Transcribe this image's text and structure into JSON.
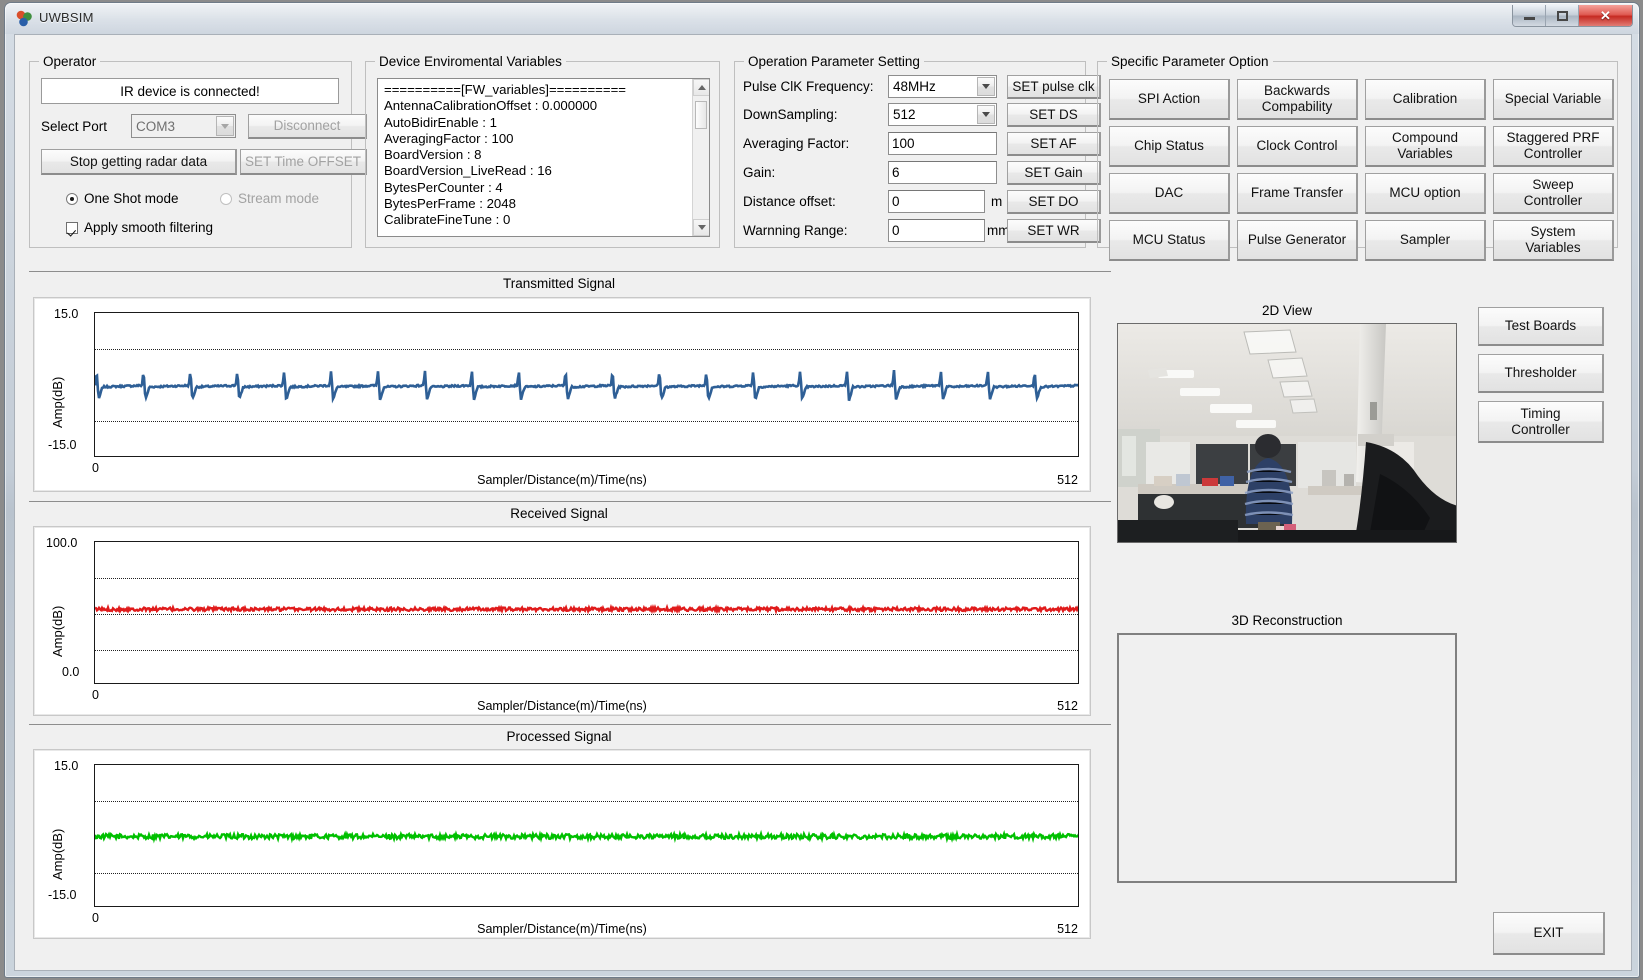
{
  "window": {
    "title": "UWBSIM",
    "minimize_label": "minimize",
    "maximize_label": "maximize",
    "close_label": "✕"
  },
  "operator": {
    "legend": "Operator",
    "status": "IR device is connected!",
    "select_port_label": "Select Port",
    "port_value": "COM3",
    "disconnect_label": "Disconnect",
    "stop_label": "Stop getting radar data",
    "time_offset_label": "SET Time OFFSET",
    "one_shot_label": "One Shot mode",
    "stream_label": "Stream mode",
    "smooth_label": "Apply smooth filtering"
  },
  "device_vars": {
    "legend": "Device Enviromental Variables",
    "text": "==========[FW_variables]==========\nAntennaCalibrationOffset : 0.000000\nAutoBidirEnable : 1\nAveragingFactor : 100\nBoardVersion : 8\nBoardVersion_LiveRead : 16\nBytesPerCounter : 4\nBytesPerFrame : 2048\nCalibrateFineTune : 0"
  },
  "operation": {
    "legend": "Operation Parameter Setting",
    "rows": [
      {
        "label": "Pulse ClK Frequency:",
        "value": "48MHz",
        "kind": "combo",
        "unit": "",
        "button": "SET pulse clk"
      },
      {
        "label": "DownSampling:",
        "value": "512",
        "kind": "combo",
        "unit": "",
        "button": "SET DS"
      },
      {
        "label": "Averaging Factor:",
        "value": "100",
        "kind": "text",
        "unit": "",
        "button": "SET AF"
      },
      {
        "label": "Gain:",
        "value": "6",
        "kind": "text",
        "unit": "",
        "button": "SET Gain"
      },
      {
        "label": "Distance offset:",
        "value": "0",
        "kind": "text",
        "unit": "m",
        "button": "SET DO"
      },
      {
        "label": "Warnning Range:",
        "value": "0",
        "kind": "text",
        "unit": "mm",
        "button": "SET WR"
      }
    ]
  },
  "specific": {
    "legend": "Specific Parameter Option",
    "buttons": [
      "SPI Action",
      "Backwards\nCompability",
      "Calibration",
      "Special Variable",
      "Chip Status",
      "Clock Control",
      "Compound\nVariables",
      "Staggered PRF\nController",
      "DAC",
      "Frame Transfer",
      "MCU option",
      "Sweep\nController",
      "MCU Status",
      "Pulse Generator",
      "Sampler",
      "System\nVariables"
    ]
  },
  "side_buttons": {
    "test_boards": "Test Boards",
    "thresholder": "Thresholder",
    "timing_controller": "Timing\nController",
    "exit": "EXIT"
  },
  "views": {
    "view_2d_title": "2D View",
    "recon_title": "3D Reconstruction"
  },
  "chart_data": [
    {
      "type": "line",
      "title": "Transmitted Signal",
      "ylabel": "Amp(dB)",
      "xlabel": "Sampler/Distance(m)/Time(ns)",
      "yticks": [
        "15.0",
        "-15.0"
      ],
      "ylim": [
        -15.0,
        15.0
      ],
      "xticks": [
        "0",
        "512"
      ],
      "xlim": [
        0,
        512
      ],
      "grid": true,
      "gridlines_y": [
        7.5,
        -7.5
      ],
      "series": [
        {
          "name": "transmitted",
          "color": "#2e5f96",
          "description": "Periodic sawtooth pulse train, ~21 cycles across 512 samples, baseline near 0 dB, peaks ~+3 dB, troughs ~-3 dB",
          "period_samples": 24,
          "baseline": 0.0,
          "peak": 3.2,
          "trough": -3.0,
          "cycles": 21
        }
      ]
    },
    {
      "type": "line",
      "title": "Received Signal",
      "ylabel": "Amp(dB)",
      "xlabel": "Sampler/Distance(m)/Time(ns)",
      "yticks": [
        "100.0",
        "0.0"
      ],
      "ylim": [
        0.0,
        100.0
      ],
      "xticks": [
        "0",
        "512"
      ],
      "xlim": [
        0,
        512
      ],
      "grid": true,
      "gridlines_y": [
        75.0,
        50.0,
        25.0
      ],
      "series": [
        {
          "name": "received",
          "color": "#e01b1b",
          "description": "Near-flat noisy trace at approximately 53 dB across all 512 samples",
          "baseline": 53.0,
          "noise_amplitude": 1.2
        }
      ]
    },
    {
      "type": "line",
      "title": "Processed Signal",
      "ylabel": "Amp(dB)",
      "xlabel": "Sampler/Distance(m)/Time(ns)",
      "yticks": [
        "15.0",
        "-15.0"
      ],
      "ylim": [
        -15.0,
        15.0
      ],
      "xticks": [
        "0",
        "512"
      ],
      "xlim": [
        0,
        512
      ],
      "grid": true,
      "gridlines_y": [
        7.5,
        -7.5
      ],
      "series": [
        {
          "name": "processed",
          "color": "#00c000",
          "description": "Near-flat noisy trace at approximately 0 dB across all 512 samples",
          "baseline": 0.0,
          "noise_amplitude": 0.5
        }
      ]
    }
  ]
}
